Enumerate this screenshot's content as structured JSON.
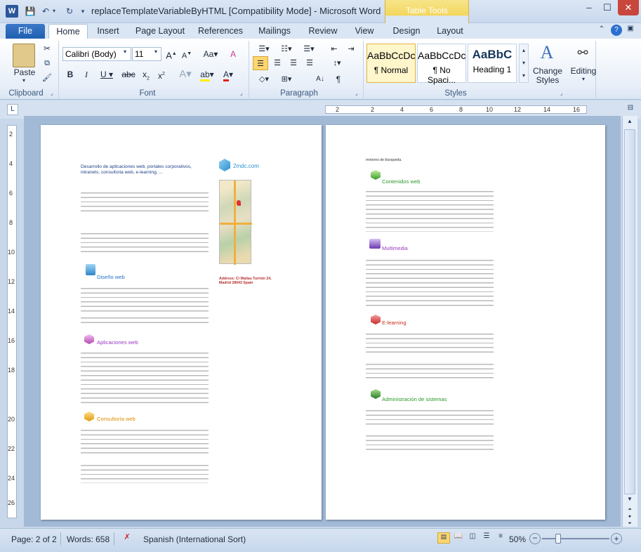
{
  "window": {
    "title": "replaceTemplateVariableByHTML [Compatibility Mode] - Microsoft Word",
    "table_tools": "Table Tools"
  },
  "tabs": {
    "file": "File",
    "home": "Home",
    "insert": "Insert",
    "page_layout": "Page Layout",
    "references": "References",
    "mailings": "Mailings",
    "review": "Review",
    "view": "View",
    "design": "Design",
    "layout": "Layout"
  },
  "ribbon": {
    "paste": "Paste",
    "clipboard": "Clipboard",
    "font_name": "Calibri (Body)",
    "font_size": "11",
    "font": "Font",
    "paragraph": "Paragraph",
    "styles": "Styles",
    "style_sample_1": "AaBbCcDc",
    "style_sample_2": "AaBbCcDc",
    "style_sample_3": "AaBbC",
    "style_normal": "¶ Normal",
    "style_nospacing": "¶ No Spaci...",
    "style_heading1": "Heading 1",
    "change_styles": "Change\nStyles",
    "editing": "Editing"
  },
  "ruler": {
    "labels": [
      "2",
      "2",
      "4",
      "6",
      "8",
      "10",
      "12",
      "14",
      "16"
    ],
    "v_labels": [
      "2",
      "4",
      "6",
      "8",
      "10",
      "12",
      "14",
      "16",
      "18",
      "20",
      "22",
      "24",
      "26"
    ]
  },
  "page1": {
    "intro_title": "Desarrollo de aplicaciones web, portales corporativos, intranets, consultoria web, e-learning, ...",
    "logo_text": "2mdc.com",
    "address": "Address: C/ Matías Turrión 24, Madrid 28043 Spain",
    "sections": {
      "diseno": "Diseño web",
      "aplicaciones": "Aplicaciones web",
      "consultoria": "Consultoría web"
    }
  },
  "page2": {
    "top_text": "motores de búsqueda.",
    "sections": {
      "contenidos": "Contenidos web",
      "multimedia": "Multimedia",
      "elearning": "E-learning",
      "admin": "Administración de sistemas"
    }
  },
  "status": {
    "page": "Page: 2 of 2",
    "words": "Words: 658",
    "language": "Spanish (International Sort)",
    "zoom": "50%"
  },
  "colors": {
    "accent": "#2b579a",
    "ribbon_bg": "#dbe6f4",
    "table_tools": "#f4d65c"
  }
}
